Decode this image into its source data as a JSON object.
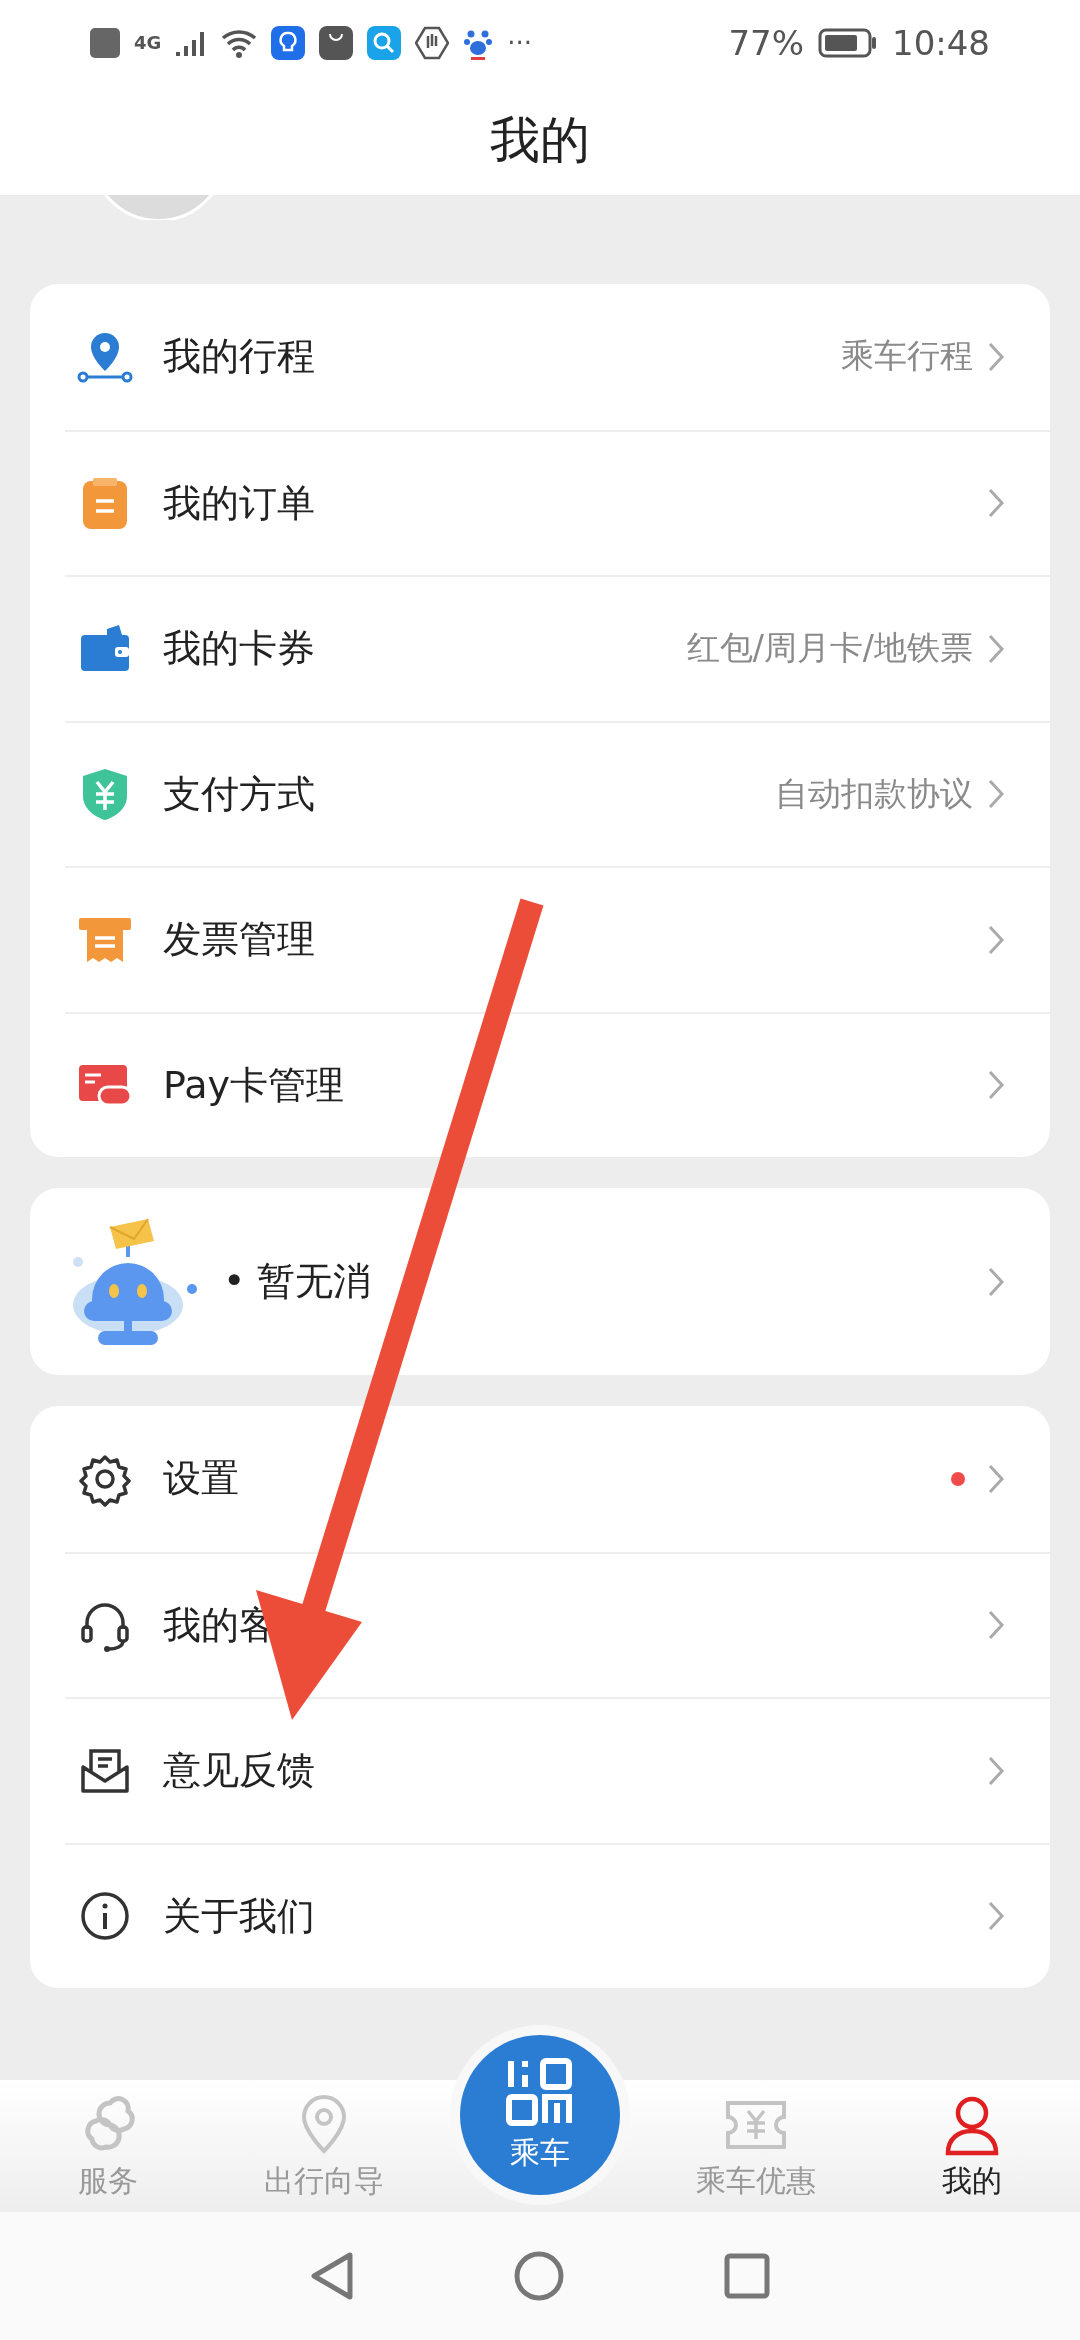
{
  "status_bar": {
    "network": "4G",
    "more": "···",
    "battery": "77%",
    "time": "10:48"
  },
  "title": "我的",
  "menu_groups": [
    {
      "kind": "list",
      "items": [
        {
          "kind": "route",
          "label": "我的行程",
          "detail": "乘车行程",
          "dot": false
        },
        {
          "kind": "order",
          "label": "我的订单",
          "dot": false
        },
        {
          "kind": "wallet",
          "label": "我的卡券",
          "detail": "红包/周月卡/地铁票",
          "dot": false
        },
        {
          "kind": "shield",
          "label": "支付方式",
          "detail": "自动扣款协议",
          "dot": false
        },
        {
          "kind": "invoice",
          "label": "发票管理",
          "dot": false
        },
        {
          "kind": "paycard",
          "label": "Pay卡管理",
          "dot": false
        }
      ]
    },
    {
      "kind": "message",
      "items": [
        {
          "kind": "robot",
          "label": "• 暂无消",
          "dot": false
        }
      ]
    },
    {
      "kind": "list",
      "items": [
        {
          "kind": "gear",
          "label": "设置",
          "dot": true
        },
        {
          "kind": "headset",
          "label": "我的客",
          "dot": false
        },
        {
          "kind": "mail",
          "label": "意见反馈",
          "dot": false
        },
        {
          "kind": "info",
          "label": "关于我们",
          "dot": false
        }
      ]
    }
  ],
  "tabs": [
    {
      "kind": "link",
      "label": "服务",
      "selected": false
    },
    {
      "kind": "pin",
      "label": "出行向导",
      "selected": false
    },
    {
      "kind": "qr",
      "label": "乘车",
      "selected": false
    },
    {
      "kind": "ticket",
      "label": "乘车优惠",
      "selected": false
    },
    {
      "kind": "person",
      "label": "我的",
      "selected": true
    }
  ]
}
